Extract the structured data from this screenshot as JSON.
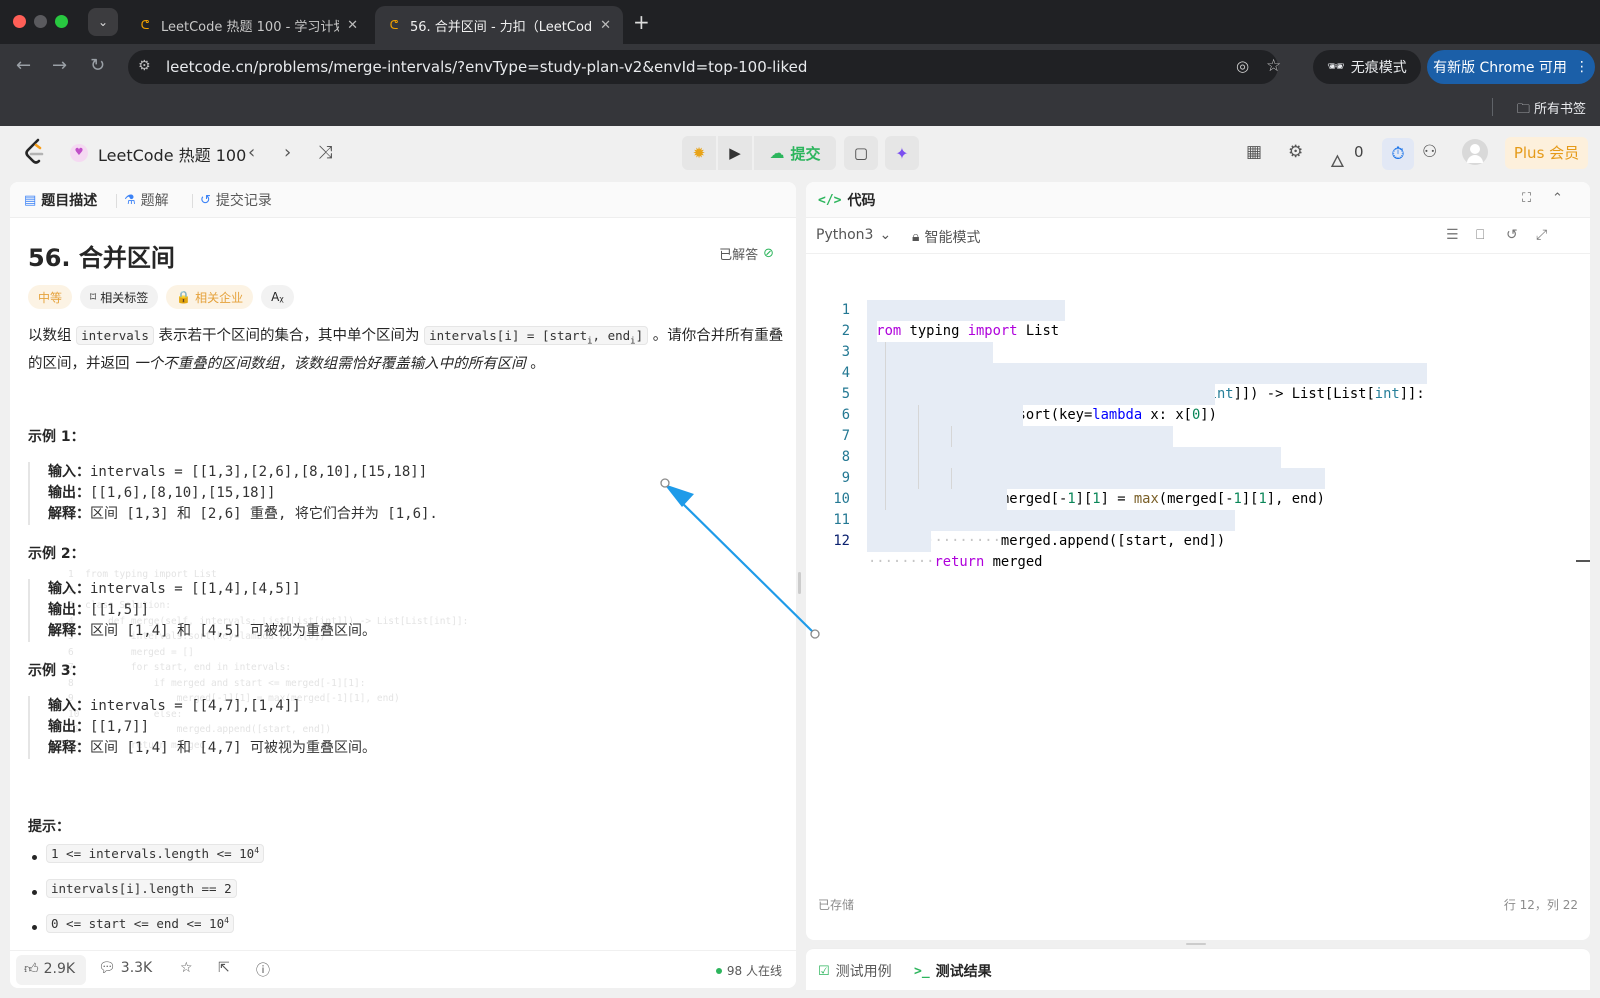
{
  "browser": {
    "tabs": [
      {
        "title": "LeetCode 热题 100 - 学习计划",
        "active": false
      },
      {
        "title": "56. 合并区间 - 力扣（LeetCode）",
        "active": true
      }
    ],
    "url": "leetcode.cn/problems/merge-intervals/?envType=study-plan-v2&envId=top-100-liked",
    "incognito_label": "无痕模式",
    "update_label": "有新版 Chrome 可用",
    "bookmarks_label": "所有书签"
  },
  "header": {
    "plan_title": "LeetCode 热题 100",
    "submit_label": "提交",
    "streak_count": "0",
    "plus_label": "Plus 会员"
  },
  "left": {
    "tabs": [
      "题目描述",
      "题解",
      "提交记录"
    ],
    "problem_title": "56. 合并区间",
    "status": "已解答",
    "tags": {
      "difficulty": "中等",
      "related": "相关标签",
      "company": "相关企业"
    },
    "description": {
      "p1": "以数组 ",
      "c1": "intervals",
      "p2": " 表示若干个区间的集合，其中单个区间为 ",
      "c2": "intervals[i] = [start",
      "c2_sub1": "i",
      "c2_mid": ", end",
      "c2_sub2": "i",
      "c2_end": "]",
      "p3": " 。请你合并所有重叠的区间，并返回 ",
      "italic": "一个不重叠的区间数组，该数组需恰好覆盖输入中的所有区间",
      "p4": " 。"
    },
    "examples": [
      {
        "title": "示例 1：",
        "input_k": "输入：",
        "input": "intervals = [[1,3],[2,6],[8,10],[15,18]]",
        "output_k": "输出：",
        "output": "[[1,6],[8,10],[15,18]]",
        "explain_k": "解释：",
        "explain": "区间 [1,3] 和 [2,6] 重叠, 将它们合并为 [1,6]."
      },
      {
        "title": "示例 2：",
        "input_k": "输入：",
        "input": "intervals = [[1,4],[4,5]]",
        "output_k": "输出：",
        "output": "[[1,5]]",
        "explain_k": "解释：",
        "explain": "区间 [1,4] 和 [4,5] 可被视为重叠区间。"
      },
      {
        "title": "示例 3：",
        "input_k": "输入：",
        "input": "intervals = [[4,7],[1,4]]",
        "output_k": "输出：",
        "output": "[[1,7]]",
        "explain_k": "解释：",
        "explain": "区间 [1,4] 和 [4,7] 可被视为重叠区间。"
      }
    ],
    "hints_title": "提示：",
    "hints": [
      {
        "text": "1 <= intervals.length <= 10",
        "sup": "4"
      },
      {
        "text": "intervals[i].length == 2",
        "sup": ""
      },
      {
        "text": "0 <= start  <= end  <= 10",
        "sup": "4"
      }
    ],
    "footer": {
      "likes": "2.9K",
      "comments": "3.3K",
      "online": "98 人在线"
    }
  },
  "right": {
    "tab_title": "代码",
    "language": "Python3",
    "mode": "智能模式",
    "saved": "已存储",
    "cursor": "行 12，列 22",
    "bottom_tabs": [
      "测试用例",
      "测试结果"
    ]
  },
  "colors": {
    "accent_green": "#2db55d",
    "difficulty_orange": "#e5a23c",
    "chrome_update_blue": "#1b5fa8",
    "annotation_arrow": "#1e9be9"
  }
}
